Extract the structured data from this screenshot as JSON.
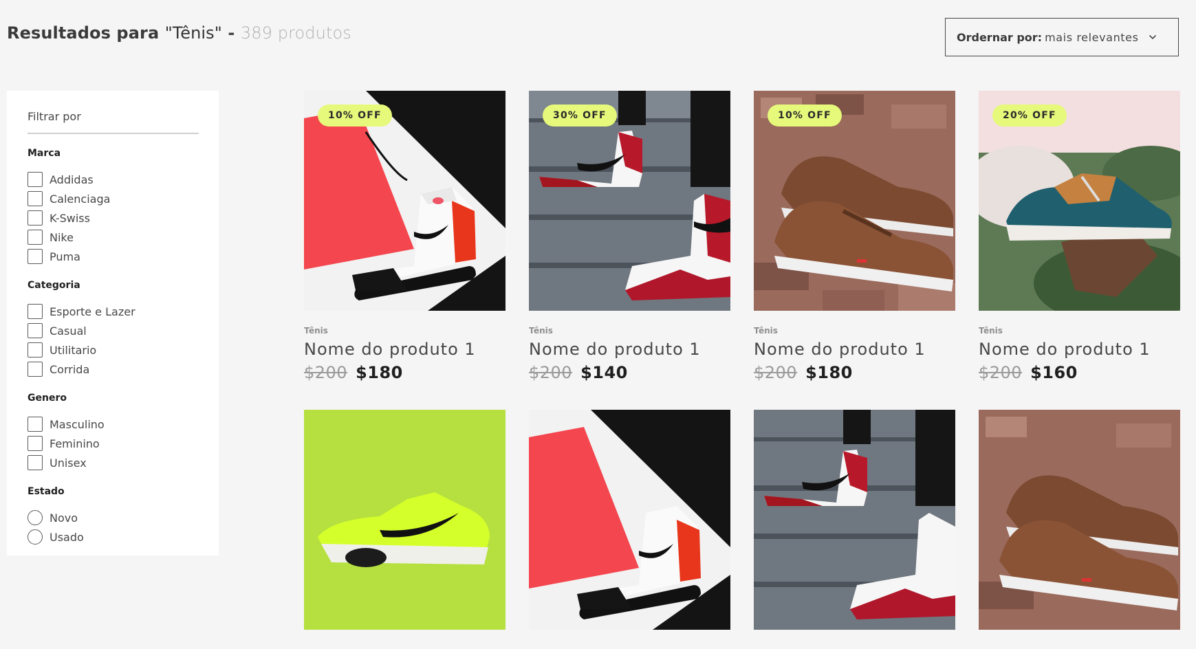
{
  "header": {
    "title_prefix": "Resultados para ",
    "query": "\"Tênis\"",
    "separator": " - ",
    "count": "389 produtos"
  },
  "sort": {
    "label": "Ordernar por:",
    "value": "mais relevantes",
    "icon": "chevron-down-icon"
  },
  "filters": {
    "title": "Filtrar por",
    "marca": {
      "title": "Marca",
      "options": [
        "Addidas",
        "Calenciaga",
        "K-Swiss",
        "Nike",
        "Puma"
      ]
    },
    "categoria": {
      "title": "Categoria",
      "options": [
        "Esporte e Lazer",
        "Casual",
        "Utilitario",
        "Corrida"
      ]
    },
    "genero": {
      "title": "Genero",
      "options": [
        "Masculino",
        "Feminino",
        "Unisex"
      ]
    },
    "estado": {
      "title": "Estado",
      "options": [
        "Novo",
        "Usado"
      ]
    }
  },
  "products": [
    {
      "badge": "10% OFF",
      "category": "Tênis",
      "name": "Nome do produto 1",
      "old_price": "$200",
      "price": "$180",
      "image": "jordan-low-red-black"
    },
    {
      "badge": "30% OFF",
      "category": "Tênis",
      "name": "Nome do produto 1",
      "old_price": "$200",
      "price": "$140",
      "image": "jordan-high-stairs"
    },
    {
      "badge": "10% OFF",
      "category": "Tênis",
      "name": "Nome do produto 1",
      "old_price": "$200",
      "price": "$180",
      "image": "brown-casual-sneakers"
    },
    {
      "badge": "20% OFF",
      "category": "Tênis",
      "name": "Nome do produto 1",
      "old_price": "$200",
      "price": "$160",
      "image": "blue-runner-in-hand"
    },
    {
      "image": "nike-neon-green"
    },
    {
      "image": "jordan-low-red-black"
    },
    {
      "image": "jordan-high-stairs"
    },
    {
      "image": "brown-casual-sneakers"
    }
  ],
  "colors": {
    "badge_bg": "#e6f97a",
    "background": "#f5f5f5",
    "text": "#474747"
  }
}
